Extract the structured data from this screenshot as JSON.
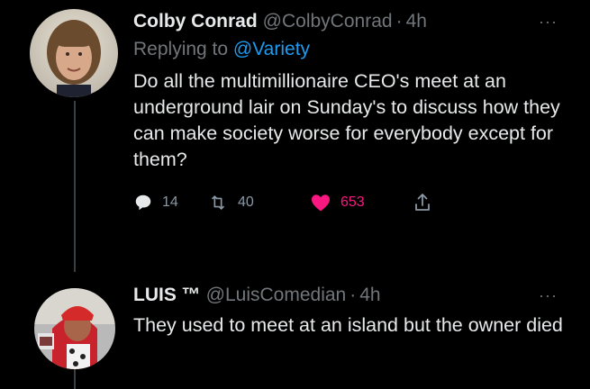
{
  "tweets": [
    {
      "name": "Colby Conrad",
      "handle": "@ColbyConrad",
      "time": "4h",
      "reply_prefix": "Replying to ",
      "reply_to": "@Variety",
      "text": "Do all the multimillionaire CEO's meet at an underground lair on Sunday's to discuss how they can make society worse for everybody except for them?",
      "replies": "14",
      "retweets": "40",
      "likes": "653",
      "liked": true
    },
    {
      "name": "LUIS ™",
      "handle": "@LuisComedian",
      "time": "4h",
      "text": "They used to meet at an island but the owner died"
    }
  ],
  "separator": "·",
  "more_glyph": "···",
  "colors": {
    "background": "#000000",
    "text": "#e7e9ea",
    "secondary": "#71767b",
    "link": "#1d9bf0",
    "like": "#f91880"
  },
  "icons": [
    "reply-icon",
    "retweet-icon",
    "heart-icon",
    "share-icon",
    "more-icon"
  ]
}
